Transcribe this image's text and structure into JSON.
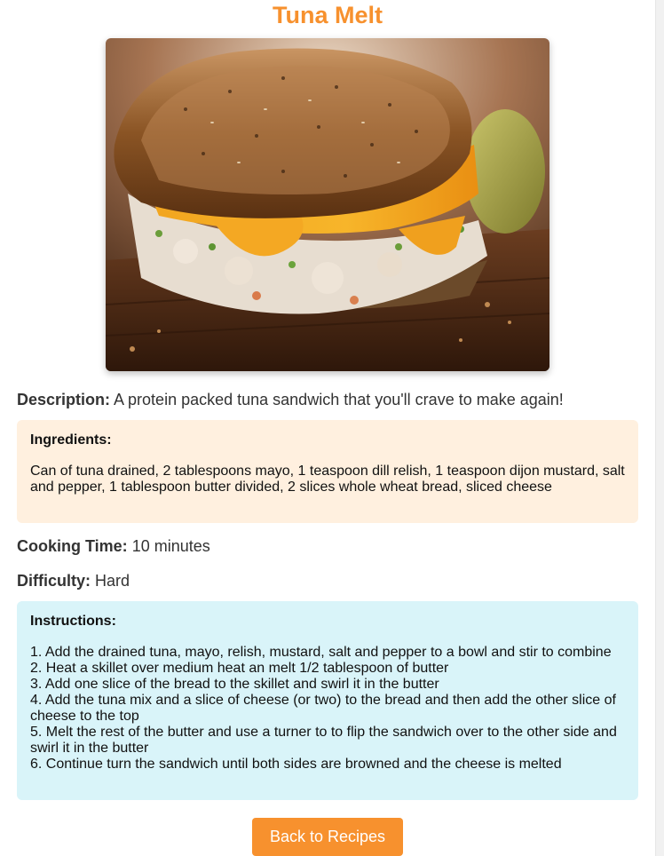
{
  "recipe": {
    "title": "Tuna Melt",
    "image_alt": "Tuna Melt",
    "description_label": "Description:",
    "description": "A protein packed tuna sandwich that you'll crave to make again!",
    "ingredients_label": "Ingredients:",
    "ingredients": "Can of tuna drained, 2 tablespoons mayo, 1 teaspoon dill relish, 1 teaspoon dijon mustard, salt and pepper, 1 tablespoon butter divided, 2 slices whole wheat bread, sliced cheese",
    "cooking_time_label": "Cooking Time:",
    "cooking_time": "10 minutes",
    "difficulty_label": "Difficulty:",
    "difficulty": "Hard",
    "instructions_label": "Instructions:",
    "instructions": "1. Add the drained tuna, mayo, relish, mustard, salt and pepper to a bowl and stir to combine\n2. Heat a skillet over medium heat an melt 1/2 tablespoon of butter\n3. Add one slice of the bread to the skillet and swirl it in the butter\n4. Add the tuna mix and a slice of cheese (or two) to the bread and then add the other slice of cheese to the top\n5. Melt the rest of the butter and use a turner to to flip the sandwich over to the other side and swirl it in the butter\n6. Continue turn the sandwich until both sides are browned and the cheese is melted"
  },
  "actions": {
    "back_label": "Back to Recipes"
  },
  "colors": {
    "accent": "#f7912e",
    "ingredients_bg": "#fff0df",
    "instructions_bg": "#d9f4f9"
  }
}
